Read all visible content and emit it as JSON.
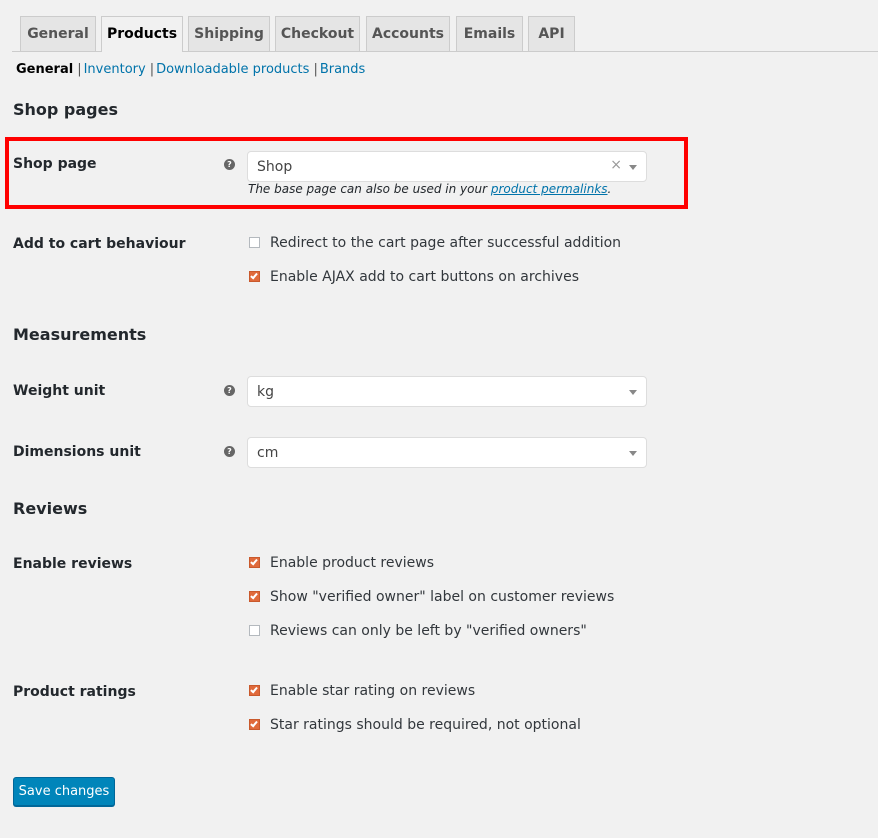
{
  "tabs": [
    {
      "label": "General"
    },
    {
      "label": "Products",
      "active": true
    },
    {
      "label": "Shipping"
    },
    {
      "label": "Checkout"
    },
    {
      "label": "Accounts"
    },
    {
      "label": "Emails"
    },
    {
      "label": "API"
    }
  ],
  "subnav": {
    "current": "General",
    "links": [
      "Inventory",
      "Downloadable products",
      "Brands"
    ]
  },
  "sections": {
    "shop_pages": "Shop pages",
    "measurements": "Measurements",
    "reviews": "Reviews"
  },
  "shop_page": {
    "label": "Shop page",
    "value": "Shop",
    "clear_symbol": "×",
    "desc_prefix": "The base page can also be used in your ",
    "desc_link": "product permalinks",
    "desc_suffix": "."
  },
  "add_to_cart": {
    "label": "Add to cart behaviour",
    "options": [
      {
        "label": "Redirect to the cart page after successful addition",
        "checked": false
      },
      {
        "label": "Enable AJAX add to cart buttons on archives",
        "checked": true
      }
    ]
  },
  "weight_unit": {
    "label": "Weight unit",
    "value": "kg"
  },
  "dimensions_unit": {
    "label": "Dimensions unit",
    "value": "cm"
  },
  "enable_reviews": {
    "label": "Enable reviews",
    "options": [
      {
        "label": "Enable product reviews",
        "checked": true
      },
      {
        "label": "Show \"verified owner\" label on customer reviews",
        "checked": true
      },
      {
        "label": "Reviews can only be left by \"verified owners\"",
        "checked": false
      }
    ]
  },
  "product_ratings": {
    "label": "Product ratings",
    "options": [
      {
        "label": "Enable star rating on reviews",
        "checked": true
      },
      {
        "label": "Star ratings should be required, not optional",
        "checked": true
      }
    ]
  },
  "help_icon_glyph": "?",
  "save_button": "Save changes",
  "colors": {
    "accent": "#0073aa",
    "button": "#0085ba",
    "checkbox_on": "#e06a3b",
    "highlight": "#ff0000"
  }
}
